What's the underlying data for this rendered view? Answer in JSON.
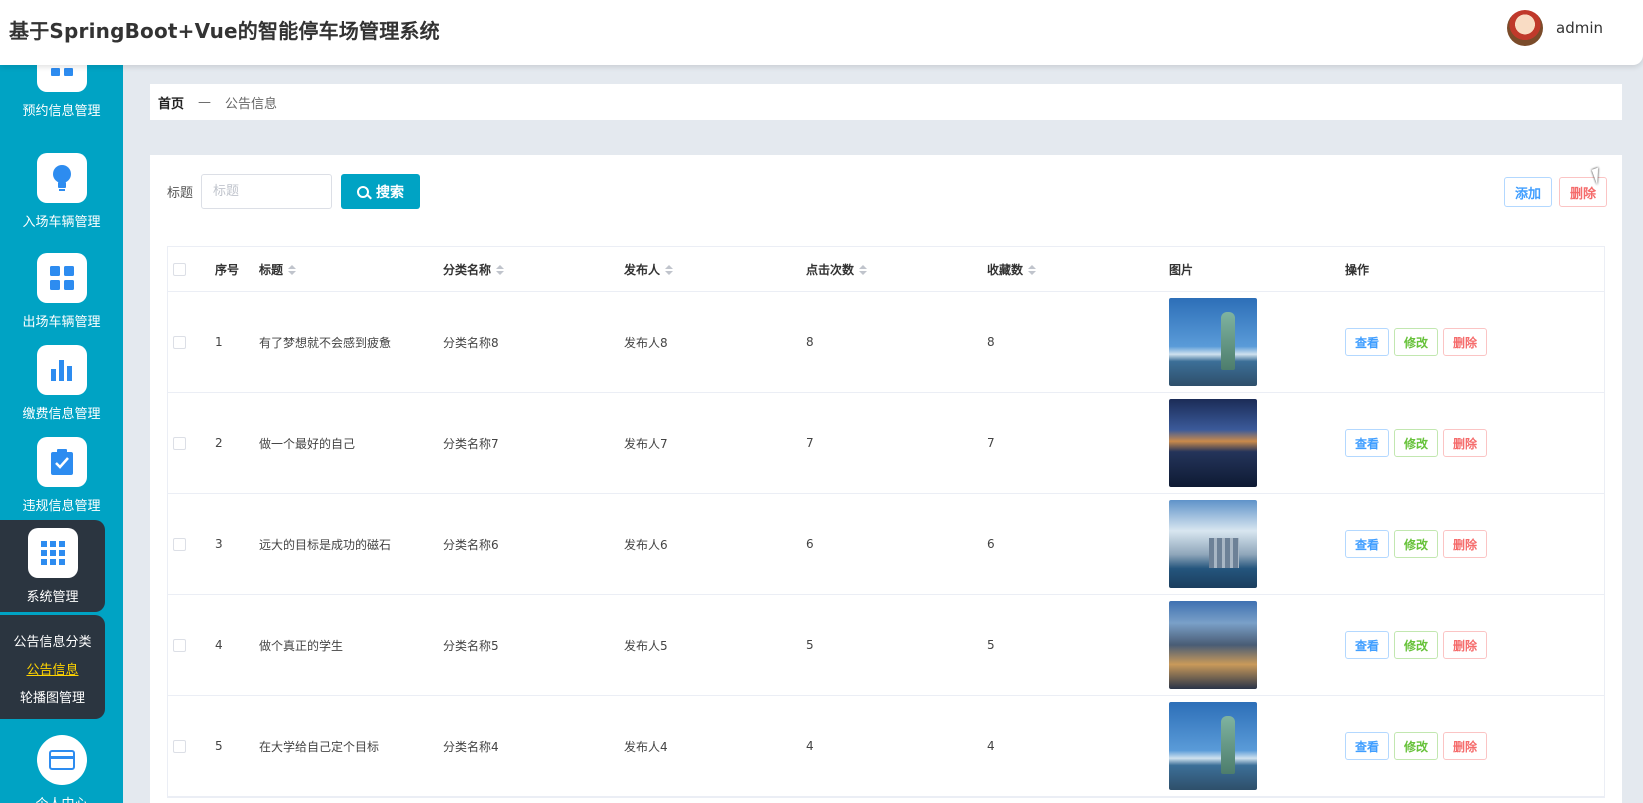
{
  "header": {
    "title": "基于SpringBoot+Vue的智能停车场管理系统",
    "username": "admin"
  },
  "sidebar": {
    "items": [
      {
        "label": "预约信息管理",
        "icon": "grid-icon"
      },
      {
        "label": "入场车辆管理",
        "icon": "bulb-icon"
      },
      {
        "label": "出场车辆管理",
        "icon": "apps-icon"
      },
      {
        "label": "缴费信息管理",
        "icon": "bar-chart-icon"
      },
      {
        "label": "违规信息管理",
        "icon": "clipboard-check-icon"
      },
      {
        "label": "系统管理",
        "icon": "grid-nine-icon"
      },
      {
        "label": "个人中心",
        "icon": "card-icon"
      }
    ],
    "submenu": [
      "公告信息分类",
      "公告信息",
      "轮播图管理"
    ]
  },
  "breadcrumb": {
    "home": "首页",
    "sep": "—",
    "current": "公告信息"
  },
  "search": {
    "label": "标题",
    "placeholder": "标题",
    "button": "搜索"
  },
  "actions": {
    "add": "添加",
    "delete": "删除"
  },
  "table": {
    "headers": [
      "序号",
      "标题",
      "分类名称",
      "发布人",
      "点击次数",
      "收藏数",
      "图片",
      "操作"
    ],
    "rows": [
      {
        "idx": "1",
        "title": "有了梦想就不会感到疲惫",
        "category": "分类名称8",
        "publisher": "发布人8",
        "clicks": "8",
        "favorites": "8",
        "image": "statue-of-liberty"
      },
      {
        "idx": "2",
        "title": "做一个最好的自己",
        "category": "分类名称7",
        "publisher": "发布人7",
        "clicks": "7",
        "favorites": "7",
        "image": "night-harbor"
      },
      {
        "idx": "3",
        "title": "远大的目标是成功的磁石",
        "category": "分类名称6",
        "publisher": "发布人6",
        "clicks": "6",
        "favorites": "6",
        "image": "city-towers"
      },
      {
        "idx": "4",
        "title": "做个真正的学生",
        "category": "分类名称5",
        "publisher": "发布人5",
        "clicks": "5",
        "favorites": "5",
        "image": "city-aerial"
      },
      {
        "idx": "5",
        "title": "在大学给自己定个目标",
        "category": "分类名称4",
        "publisher": "发布人4",
        "clicks": "4",
        "favorites": "4",
        "image": "statue-of-liberty"
      }
    ],
    "row_ops": {
      "view": "查看",
      "edit": "修改",
      "delete": "删除"
    }
  },
  "colors": {
    "primary": "#00a3c4",
    "sidebar_active": "#2b3540",
    "danger": "#f56c6c",
    "success": "#67c23a",
    "info": "#409eff"
  }
}
